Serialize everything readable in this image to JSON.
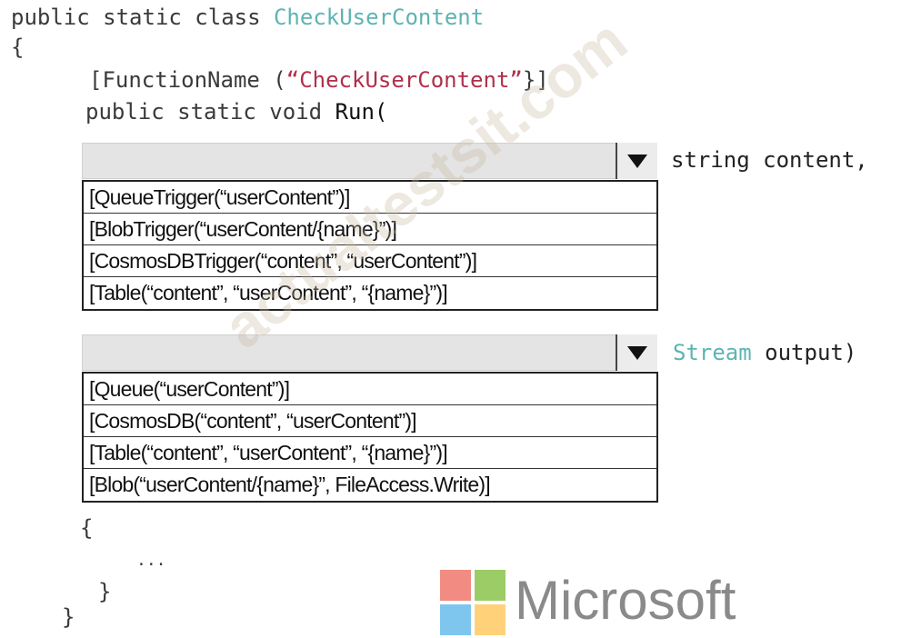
{
  "code": {
    "line1": {
      "prefix": "public static class ",
      "class_name": "CheckUserContent"
    },
    "line2": "{",
    "line3": {
      "open": "[FunctionName (",
      "name": "“CheckUserContent”",
      "close": "}]"
    },
    "line4": {
      "prefix": "public static void ",
      "method": "Run("
    },
    "body_open": "{",
    "ellipsis": "...",
    "body_close": "}",
    "class_close": "}"
  },
  "dropdown1": {
    "selected": "",
    "after_type": "",
    "after_text": "string content,",
    "options": [
      "[QueueTrigger(“userContent”)]",
      "[BlobTrigger(“userContent/{name}”)]",
      "[CosmosDBTrigger(“content”, “userContent”)]",
      "[Table(“content”, “userContent”, “{name}”)]"
    ]
  },
  "dropdown2": {
    "selected": "",
    "after_type": "Stream",
    "after_text": " output)",
    "options": [
      "[Queue(“userContent”)]",
      "[CosmosDB(“content”, “userContent”)]",
      "[Table(“content”, “userContent”, “{name}”)]",
      "[Blob(“userContent/{name}”, FileAccess.Write)]"
    ]
  },
  "watermark": "actualtestsit.com",
  "brand": {
    "name": "Microsoft",
    "colors": {
      "red": "#f25022",
      "green": "#7fba00",
      "blue": "#00a4ef",
      "yellow": "#ffb900"
    }
  },
  "icons": {
    "dropdown_arrow": "caret-down-icon"
  }
}
